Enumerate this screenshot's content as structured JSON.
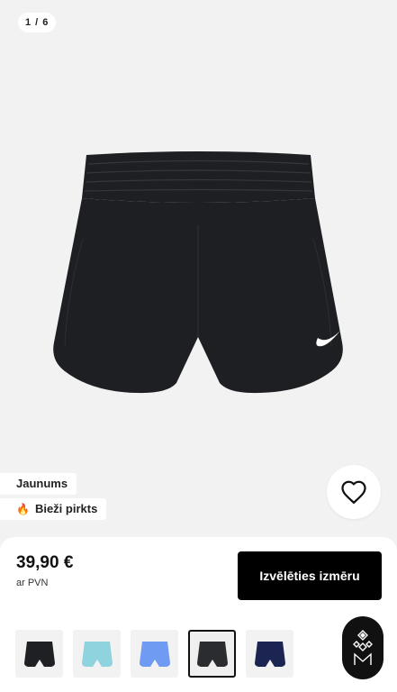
{
  "gallery": {
    "counter": "1 / 6",
    "image_alt": "Black running shorts",
    "shorts_color": "#1d1f22",
    "swoosh_color": "#ffffff"
  },
  "badges": [
    {
      "label": "Jaunums"
    },
    {
      "label": "Bieži pirkts",
      "icon": "fire-icon"
    }
  ],
  "wishlist": {
    "icon": "heart-outline-icon"
  },
  "purchase": {
    "price": "39,90 €",
    "vat_note": "ar PVN",
    "size_button_label": "Izvēlēties izmēru"
  },
  "variants": [
    {
      "color": "#1f2024",
      "selected": false
    },
    {
      "color": "#8fd3df",
      "selected": false
    },
    {
      "color": "#6f9bf2",
      "selected": false
    },
    {
      "color": "#2a2c30",
      "selected": true
    },
    {
      "color": "#1c2452",
      "selected": false
    }
  ],
  "brand_logo": {
    "icon": "diamond-monogram-icon"
  }
}
